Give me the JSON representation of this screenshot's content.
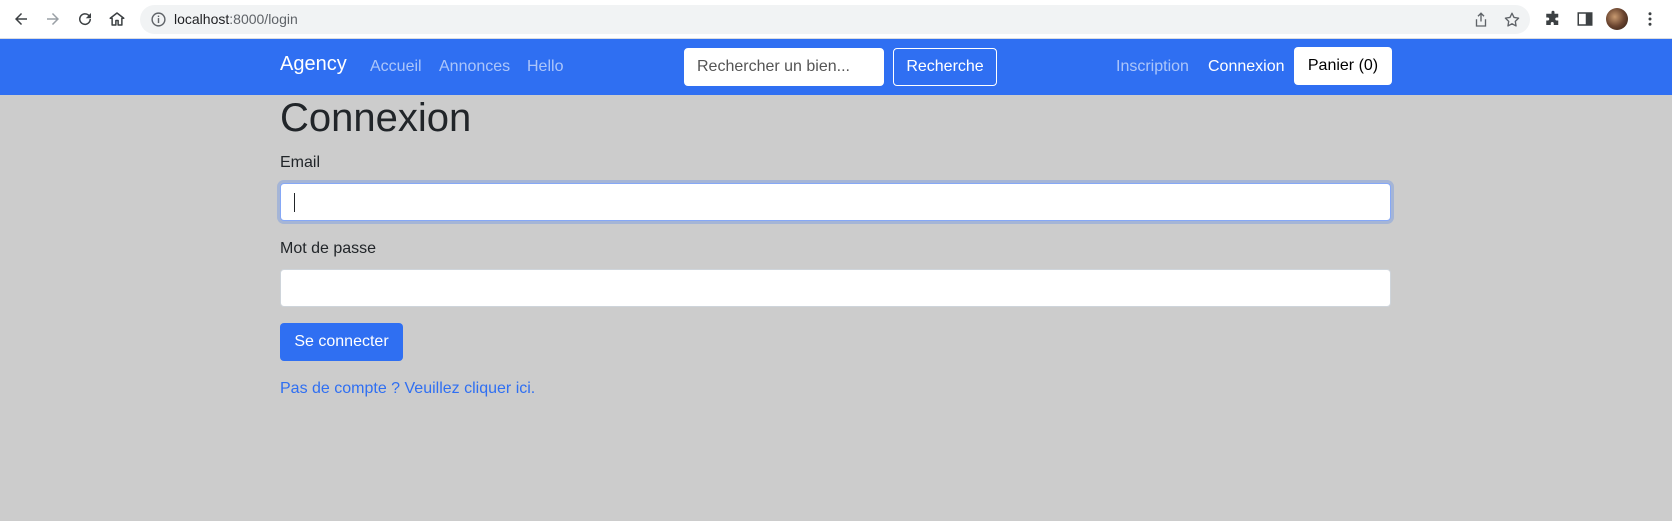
{
  "browser": {
    "url_host": "localhost",
    "url_path": ":8000/login"
  },
  "navbar": {
    "brand": "Agency",
    "links": [
      {
        "label": "Accueil"
      },
      {
        "label": "Annonces"
      },
      {
        "label": "Hello"
      }
    ],
    "search": {
      "placeholder": "Rechercher un bien...",
      "button_label": "Recherche"
    },
    "right_links": [
      {
        "label": "Inscription"
      },
      {
        "label": "Connexion"
      }
    ],
    "cart_label": "Panier (0)"
  },
  "main": {
    "title": "Connexion",
    "email_label": "Email",
    "email_value": "",
    "password_label": "Mot de passe",
    "password_value": "",
    "submit_label": "Se connecter",
    "signup_link": "Pas de compte ? Veuillez cliquer ici."
  },
  "colors": {
    "primary": "#2f6ff2",
    "page_background": "#cccccc"
  }
}
